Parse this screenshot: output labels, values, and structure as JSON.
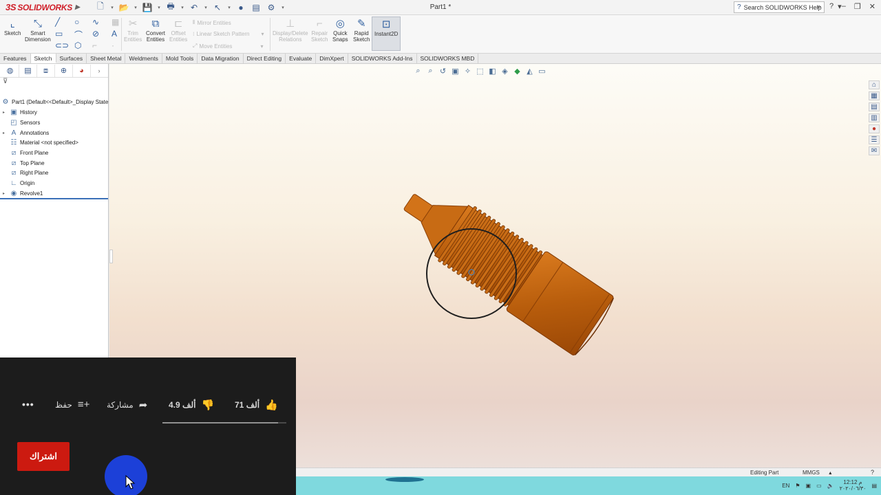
{
  "app": {
    "brand": "SOLIDWORKS",
    "brand_prefix": "3S",
    "doc_title": "Part1 *",
    "search_placeholder": "Search SOLIDWORKS Help"
  },
  "ribbon": {
    "sketch": "Sketch",
    "smart_dimension_1": "Smart",
    "smart_dimension_2": "Dimension",
    "trim_1": "Trim",
    "trim_2": "Entities",
    "convert_1": "Convert",
    "convert_2": "Entities",
    "offset_1": "Offset",
    "offset_2": "Entities",
    "mirror": "Mirror Entities",
    "linear_pattern": "Linear Sketch Pattern",
    "move": "Move Entities",
    "display_delete_1": "Display/Delete",
    "display_delete_2": "Relations",
    "repair_1": "Repair",
    "repair_2": "Sketch",
    "quick_snaps_1": "Quick",
    "quick_snaps_2": "Snaps",
    "rapid_sketch_1": "Rapid",
    "rapid_sketch_2": "Sketch",
    "instant2d": "Instant2D"
  },
  "tabs": [
    "Features",
    "Sketch",
    "Surfaces",
    "Sheet Metal",
    "Weldments",
    "Mold Tools",
    "Data Migration",
    "Direct Editing",
    "Evaluate",
    "DimXpert",
    "SOLIDWORKS Add-Ins",
    "SOLIDWORKS MBD"
  ],
  "active_tab": "Sketch",
  "tree": {
    "root": "Part1  (Default<<Default>_Display State",
    "items": [
      "History",
      "Sensors",
      "Annotations",
      "Material <not specified>",
      "Front Plane",
      "Top Plane",
      "Right Plane",
      "Origin",
      "Revolve1"
    ]
  },
  "status": {
    "mode": "Editing Part",
    "units": "MMGS"
  },
  "taskbar": {
    "lang": "EN",
    "time": "12:12 م",
    "date": "٢٠٢٠/٠٦/٣٠"
  },
  "youtube": {
    "likes": "71 ألف",
    "dislikes": "4.9 ألف",
    "share": "مشاركة",
    "save": "حفظ",
    "more": "•••",
    "subscribe": "اشتراك",
    "like_ratio": 0.935
  },
  "colors": {
    "part": "#c0620f",
    "brand": "#d0202a",
    "subscribe": "#cc1a10",
    "cursor_highlight": "#1c40d8"
  }
}
